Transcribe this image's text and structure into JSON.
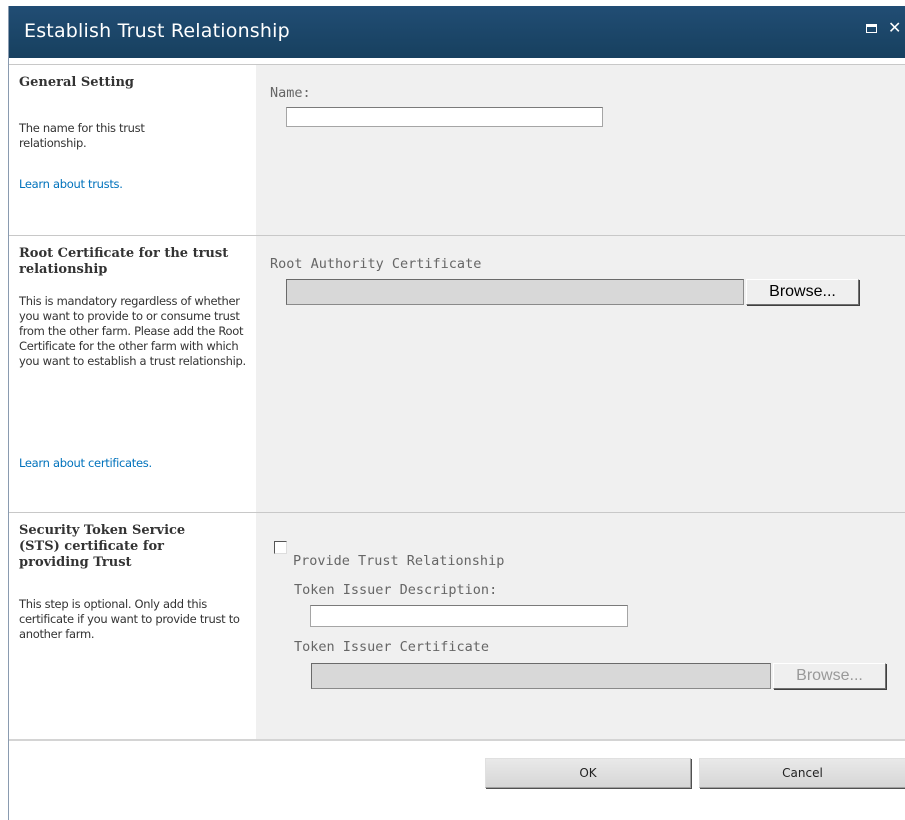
{
  "dialog": {
    "title": "Establish Trust Relationship"
  },
  "general": {
    "title": "General Setting",
    "description": "The name for this trust relationship.",
    "link": "Learn about trusts.",
    "name_label": "Name:",
    "name_value": ""
  },
  "root_cert": {
    "title": "Root Certificate for the trust relationship",
    "description": "This is mandatory regardless of whether you want to provide to or consume trust from the other farm. Please add the Root Certificate for the other farm with which you want to establish a trust relationship.",
    "link": "Learn about certificates.",
    "field_label": "Root Authority Certificate",
    "browse_label": "Browse..."
  },
  "sts": {
    "title": "Security Token Service (STS) certificate for providing Trust",
    "description": "This step is optional. Only add this certificate if you want to provide trust to another farm.",
    "checkbox_label": "Provide Trust Relationship",
    "checkbox_checked": false,
    "issuer_desc_label": "Token Issuer Description:",
    "issuer_desc_value": "",
    "issuer_cert_label": "Token Issuer Certificate",
    "browse_label": "Browse..."
  },
  "footer": {
    "ok_label": "OK",
    "cancel_label": "Cancel"
  }
}
